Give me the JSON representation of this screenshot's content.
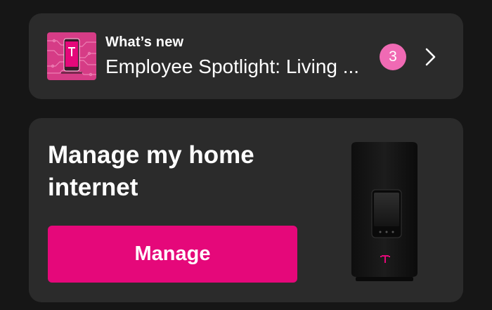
{
  "whats_new": {
    "eyebrow": "What’s new",
    "title": "Employee Spotlight: Living ...",
    "badge_count": "3",
    "thumbnail_icon": "t-mobile-phone-thumbnail",
    "chevron_icon": "chevron-right-icon"
  },
  "home_internet": {
    "title": "Manage my home internet",
    "button_label": "Manage",
    "image_icon": "home-internet-gateway-image"
  },
  "colors": {
    "background": "#161616",
    "card": "#2b2b2b",
    "accent_magenta": "#e5087a",
    "badge_pink": "#f06ab4",
    "text": "#ffffff"
  }
}
